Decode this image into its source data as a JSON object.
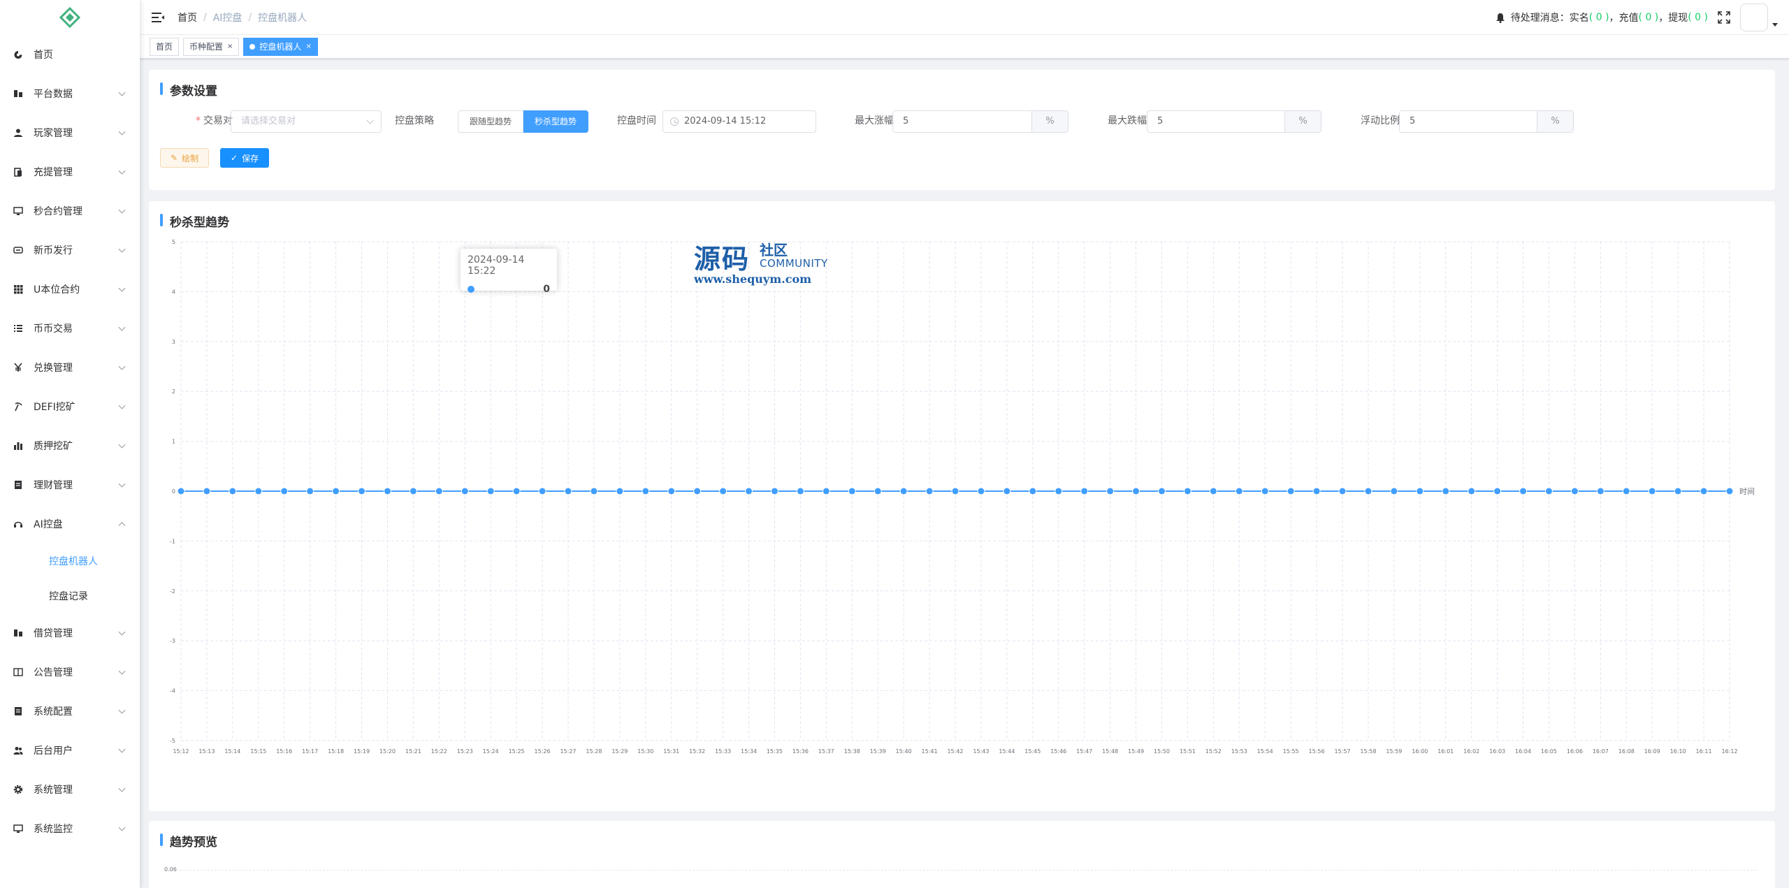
{
  "sidebar": {
    "items": [
      {
        "label": "首页",
        "icon": "dashboard-icon",
        "has_children": false
      },
      {
        "label": "平台数据",
        "icon": "chart-icon",
        "has_children": true
      },
      {
        "label": "玩家管理",
        "icon": "user-icon",
        "has_children": true
      },
      {
        "label": "充提管理",
        "icon": "clipboard-icon",
        "has_children": true
      },
      {
        "label": "秒合约管理",
        "icon": "monitor-icon",
        "has_children": true
      },
      {
        "label": "新币发行",
        "icon": "coin-icon",
        "has_children": true
      },
      {
        "label": "U本位合约",
        "icon": "grid-icon",
        "has_children": true
      },
      {
        "label": "币币交易",
        "icon": "list-icon",
        "has_children": true
      },
      {
        "label": "兑换管理",
        "icon": "yen-icon",
        "has_children": true
      },
      {
        "label": "DEFI挖矿",
        "icon": "pickaxe-icon",
        "has_children": true
      },
      {
        "label": "质押挖矿",
        "icon": "bar-chart-icon",
        "has_children": true
      },
      {
        "label": "理财管理",
        "icon": "document-icon",
        "has_children": true
      },
      {
        "label": "AI控盘",
        "icon": "robot-icon",
        "has_children": true,
        "expanded": true
      }
    ],
    "subitems": [
      {
        "label": "控盘机器人",
        "active": true
      },
      {
        "label": "控盘记录",
        "active": false
      }
    ],
    "items_after": [
      {
        "label": "借贷管理",
        "icon": "chart-icon"
      },
      {
        "label": "公告管理",
        "icon": "book-icon"
      },
      {
        "label": "系统配置",
        "icon": "document-icon"
      },
      {
        "label": "后台用户",
        "icon": "users-icon"
      },
      {
        "label": "系统管理",
        "icon": "gear-icon"
      },
      {
        "label": "系统监控",
        "icon": "monitor-icon"
      }
    ]
  },
  "header": {
    "breadcrumb": [
      "首页",
      "AI控盘",
      "控盘机器人"
    ],
    "notice_prefix": "待处理消息：",
    "notice_real": "实名",
    "notice_recharge": "充值",
    "notice_withdraw": "提现",
    "count_real": "( 0 )",
    "count_recharge": "( 0 )",
    "count_withdraw": "( 0 )",
    "sep": "，"
  },
  "tags": [
    {
      "label": "首页",
      "active": false,
      "closable": false
    },
    {
      "label": "币种配置",
      "active": false,
      "closable": true
    },
    {
      "label": "控盘机器人",
      "active": true,
      "closable": true
    }
  ],
  "params": {
    "title": "参数设置",
    "pair_label": "交易对",
    "pair_placeholder": "请选择交易对",
    "strategy_label": "控盘策略",
    "strategy_options": [
      "跟随型趋势",
      "秒杀型趋势"
    ],
    "strategy_selected": 1,
    "time_label": "控盘时间",
    "time_value": "2024-09-14 15:12",
    "max_rise_label": "最大涨幅",
    "max_rise_value": "5",
    "max_fall_label": "最大跌幅",
    "max_fall_value": "5",
    "float_label": "浮动比例",
    "float_value": "5",
    "unit": "%",
    "draw_button": "绘制",
    "save_button": "保存"
  },
  "trend": {
    "title": "秒杀型趋势",
    "tooltip_time": "2024-09-14 15:22",
    "tooltip_value": "0"
  },
  "watermark": {
    "big": "源码",
    "small": "社区",
    "community": "COMMUNITY",
    "url": "www.shequym.com"
  },
  "preview": {
    "title": "趋势预览",
    "first_tick": "0.06"
  },
  "chart_data": {
    "type": "line",
    "x": [
      "15:12",
      "15:13",
      "15:14",
      "15:15",
      "15:16",
      "15:17",
      "15:18",
      "15:19",
      "15:20",
      "15:21",
      "15:22",
      "15:23",
      "15:24",
      "15:25",
      "15:26",
      "15:27",
      "15:28",
      "15:29",
      "15:30",
      "15:31",
      "15:32",
      "15:33",
      "15:34",
      "15:35",
      "15:36",
      "15:37",
      "15:38",
      "15:39",
      "15:40",
      "15:41",
      "15:42",
      "15:43",
      "15:44",
      "15:45",
      "15:46",
      "15:47",
      "15:48",
      "15:49",
      "15:50",
      "15:51",
      "15:52",
      "15:53",
      "15:54",
      "15:55",
      "15:56",
      "15:57",
      "15:58",
      "15:59",
      "16:00",
      "16:01",
      "16:02",
      "16:03",
      "16:04",
      "16:05",
      "16:06",
      "16:07",
      "16:08",
      "16:09",
      "16:10",
      "16:11",
      "16:12"
    ],
    "values": [
      0,
      0,
      0,
      0,
      0,
      0,
      0,
      0,
      0,
      0,
      0,
      0,
      0,
      0,
      0,
      0,
      0,
      0,
      0,
      0,
      0,
      0,
      0,
      0,
      0,
      0,
      0,
      0,
      0,
      0,
      0,
      0,
      0,
      0,
      0,
      0,
      0,
      0,
      0,
      0,
      0,
      0,
      0,
      0,
      0,
      0,
      0,
      0,
      0,
      0,
      0,
      0,
      0,
      0,
      0,
      0,
      0,
      0,
      0,
      0,
      0
    ],
    "yticks": [
      "5",
      "4",
      "3",
      "2",
      "1",
      "0",
      "-1",
      "-2",
      "-3",
      "-4",
      "-5"
    ],
    "ylim": [
      -5,
      5
    ],
    "xlabel": "时间",
    "ylabel": "",
    "grid": true,
    "color": "#409eff"
  }
}
